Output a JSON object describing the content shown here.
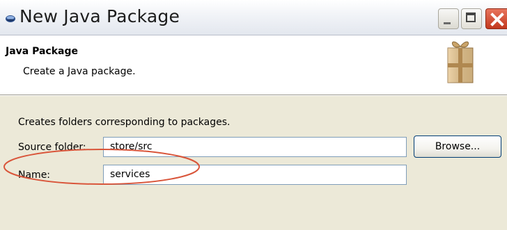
{
  "window": {
    "title": "New Java Package",
    "controls": {
      "minimize_icon": "minimize-icon",
      "maximize_icon": "maximize-icon",
      "close_icon": "close-icon"
    }
  },
  "banner": {
    "title": "Java Package",
    "description": "Create a Java package.",
    "icon": "package-box-icon"
  },
  "form": {
    "intro": "Creates folders corresponding to packages.",
    "source_folder": {
      "label": "Source folder:",
      "value": "store/src"
    },
    "name": {
      "label": "Name:",
      "value": "services"
    },
    "browse_label": "Browse..."
  },
  "colors": {
    "highlight": "#d9553a",
    "dialog_background": "#ece9d8",
    "close_button": "#c2381e"
  }
}
